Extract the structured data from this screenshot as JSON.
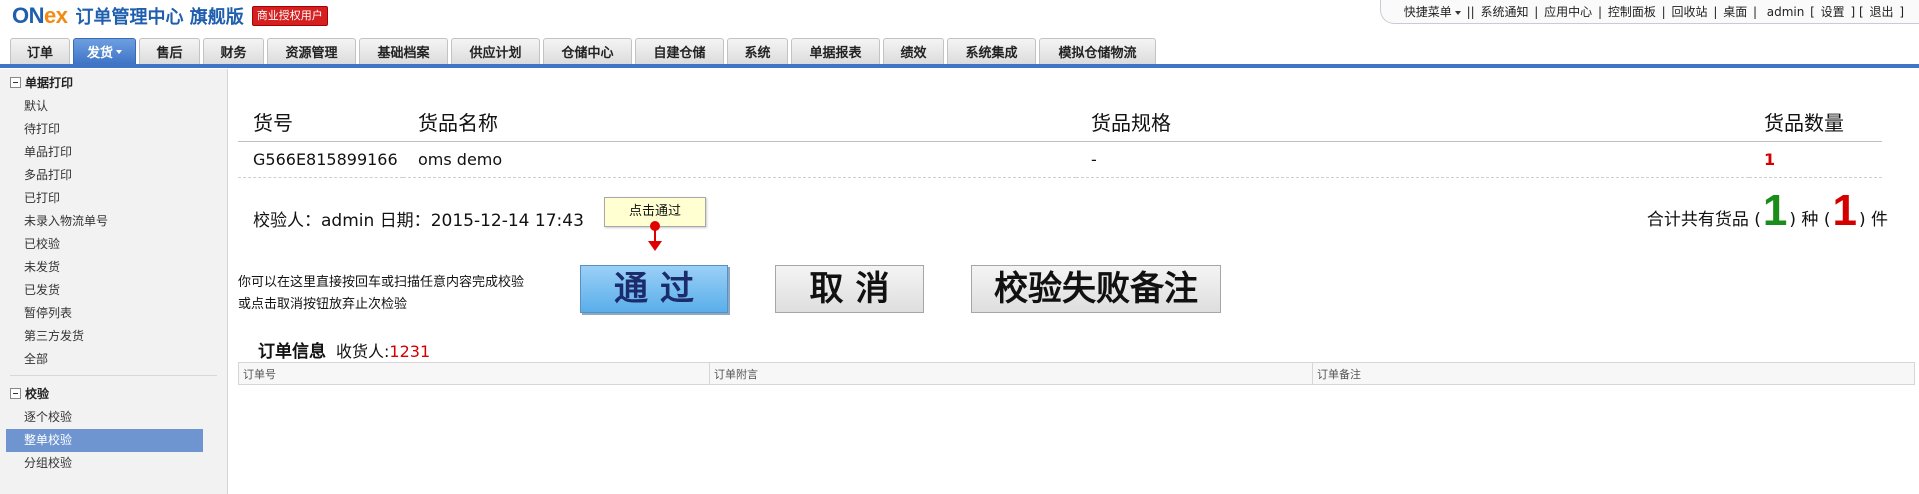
{
  "header": {
    "logo_on": "ON",
    "logo_ex": "ex",
    "app_title": "订单管理中心 旗舰版",
    "license_badge": "商业授权用户",
    "quick_menu": "快捷菜单",
    "links": [
      "系统通知",
      "应用中心",
      "控制面板",
      "回收站",
      "桌面"
    ],
    "user": "admin",
    "settings": "设置",
    "logout": "退出"
  },
  "nav": {
    "tabs": [
      "订单",
      "发货",
      "售后",
      "财务",
      "资源管理",
      "基础档案",
      "供应计划",
      "仓储中心",
      "自建仓储",
      "系统",
      "单据报表",
      "绩效",
      "系统集成",
      "模拟仓储物流"
    ],
    "active": "发货"
  },
  "sidebar": {
    "group1": {
      "title": "单据打印",
      "items": [
        "默认",
        "待打印",
        "单品打印",
        "多品打印",
        "已打印",
        "未录入物流单号",
        "已校验",
        "未发货",
        "已发货",
        "暂停列表",
        "第三方发货",
        "全部"
      ]
    },
    "group2": {
      "title": "校验",
      "items": [
        "逐个校验",
        "整单校验",
        "分组校验"
      ],
      "active": "整单校验"
    }
  },
  "goods_table": {
    "headers": [
      "货号",
      "货品名称",
      "货品规格",
      "货品数量"
    ],
    "rows": [
      {
        "sku": "G566E815899166",
        "name": "oms demo",
        "spec": "-",
        "qty": "1"
      }
    ]
  },
  "check": {
    "checker_label": "校验人：",
    "checker": "admin",
    "date_label": "日期：",
    "date": "2015-12-14 17:43",
    "totals_prefix": "合计共有货品 (",
    "kinds": "1",
    "kinds_suffix": ") 种 (",
    "pieces": "1",
    "pieces_suffix": ") 件",
    "tooltip": "点击通过",
    "hint_line1": "你可以在这里直接按回车或扫描任意内容完成校验",
    "hint_line2": "或点击取消按钮放弃止次检验",
    "btn_pass": "通过",
    "btn_cancel": "取消",
    "btn_fail": "校验失败备注"
  },
  "order_info": {
    "title": "订单信息",
    "receiver_label": "收货人:",
    "receiver": "1231",
    "columns": [
      "订单号",
      "订单附言",
      "订单备注"
    ]
  },
  "colors": {
    "accent": "#3f74c6",
    "sidebar_active": "#6f95d1",
    "pass_button": "#5aaeea",
    "quantity_red": "#d40000",
    "kinds_green": "#1a8c1a"
  }
}
